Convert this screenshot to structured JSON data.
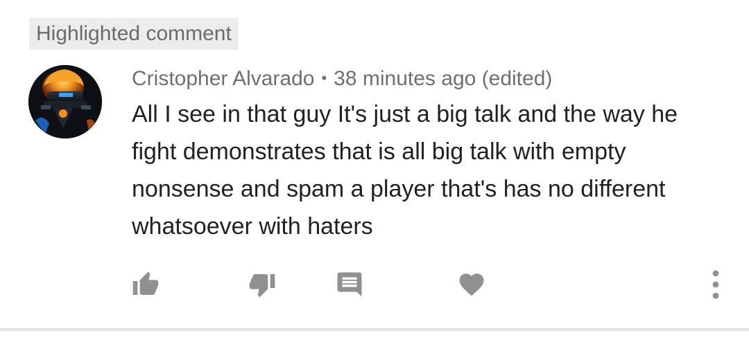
{
  "badge": {
    "label": "Highlighted comment"
  },
  "comment": {
    "author": "Cristopher Alvarado",
    "separator": "•",
    "timestamp": "38 minutes ago (edited)",
    "text": "All I see in that guy It's just a big talk and the way he fight demonstrates that is all big talk with empty nonsense and spam a player that's has no different whatsoever with haters"
  },
  "actions": {
    "like_icon": "thumbs-up-icon",
    "dislike_icon": "thumbs-down-icon",
    "reply_icon": "comment-icon",
    "heart_icon": "heart-icon",
    "menu_icon": "more-vertical-icon"
  },
  "colors": {
    "icon_gray": "#909090",
    "meta_gray": "#6f6f6f",
    "text": "#212121",
    "badge_bg": "#ececec"
  }
}
